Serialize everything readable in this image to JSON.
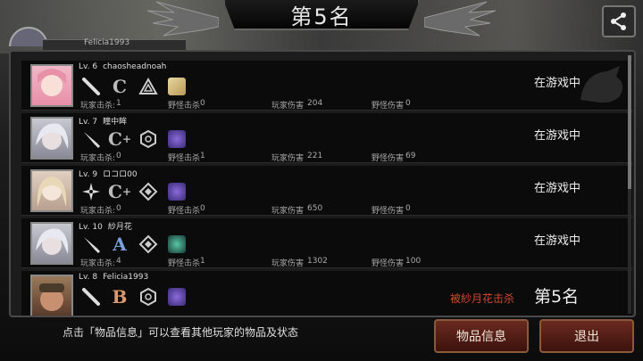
{
  "header": {
    "title": "第5名",
    "partial_name": "Felicia1993"
  },
  "players": [
    {
      "level": "Lv. 6",
      "name": "chaosheadnoah",
      "weapon_icon": "bat-icon",
      "grade": "C",
      "grade_plus": "",
      "player_kills_label": "玩家击杀:",
      "player_kills": "1",
      "monster_kills_label": "野怪击杀",
      "monster_kills": "0",
      "player_damage_label": "玩家伤害",
      "player_damage": "204",
      "monster_damage_label": "野怪伤害",
      "monster_damage": "0",
      "status": "在游戏中",
      "killed_by": "",
      "rank": ""
    },
    {
      "level": "Lv. 7",
      "name": "瞳中眸",
      "weapon_icon": "knife-icon",
      "grade": "C",
      "grade_plus": "+",
      "player_kills_label": "玩家击杀:",
      "player_kills": "0",
      "monster_kills_label": "野怪击杀",
      "monster_kills": "1",
      "player_damage_label": "玩家伤害",
      "player_damage": "221",
      "monster_damage_label": "野怪伤害",
      "monster_damage": "69",
      "status": "在游戏中",
      "killed_by": "",
      "rank": ""
    },
    {
      "level": "Lv. 9",
      "name": "ロコロ00",
      "weapon_icon": "shuriken-icon",
      "grade": "C",
      "grade_plus": "+",
      "player_kills_label": "玩家击杀:",
      "player_kills": "0",
      "monster_kills_label": "野怪击杀",
      "monster_kills": "0",
      "player_damage_label": "玩家伤害",
      "player_damage": "650",
      "monster_damage_label": "野怪伤害",
      "monster_damage": "0",
      "status": "在游戏中",
      "killed_by": "",
      "rank": ""
    },
    {
      "level": "Lv. 10",
      "name": "紗月花",
      "weapon_icon": "knife-icon",
      "grade": "A",
      "grade_plus": "",
      "player_kills_label": "玩家击杀:",
      "player_kills": "4",
      "monster_kills_label": "野怪击杀",
      "monster_kills": "1",
      "player_damage_label": "玩家伤害",
      "player_damage": "1302",
      "monster_damage_label": "野怪伤害",
      "monster_damage": "100",
      "status": "在游戏中",
      "killed_by": "",
      "rank": ""
    },
    {
      "level": "Lv. 8",
      "name": "Felicia1993",
      "weapon_icon": "bat-icon",
      "grade": "B",
      "grade_plus": "",
      "player_kills_label": "",
      "player_kills": "",
      "monster_kills_label": "",
      "monster_kills": "",
      "player_damage_label": "",
      "player_damage": "",
      "monster_damage_label": "",
      "monster_damage": "",
      "status": "",
      "killed_by": "被紗月花击杀",
      "rank": "第5名"
    }
  ],
  "footer": {
    "hint": "点击「物品信息」可以查看其他玩家的物品及状态",
    "items_button": "物品信息",
    "quit_button": "退出"
  }
}
